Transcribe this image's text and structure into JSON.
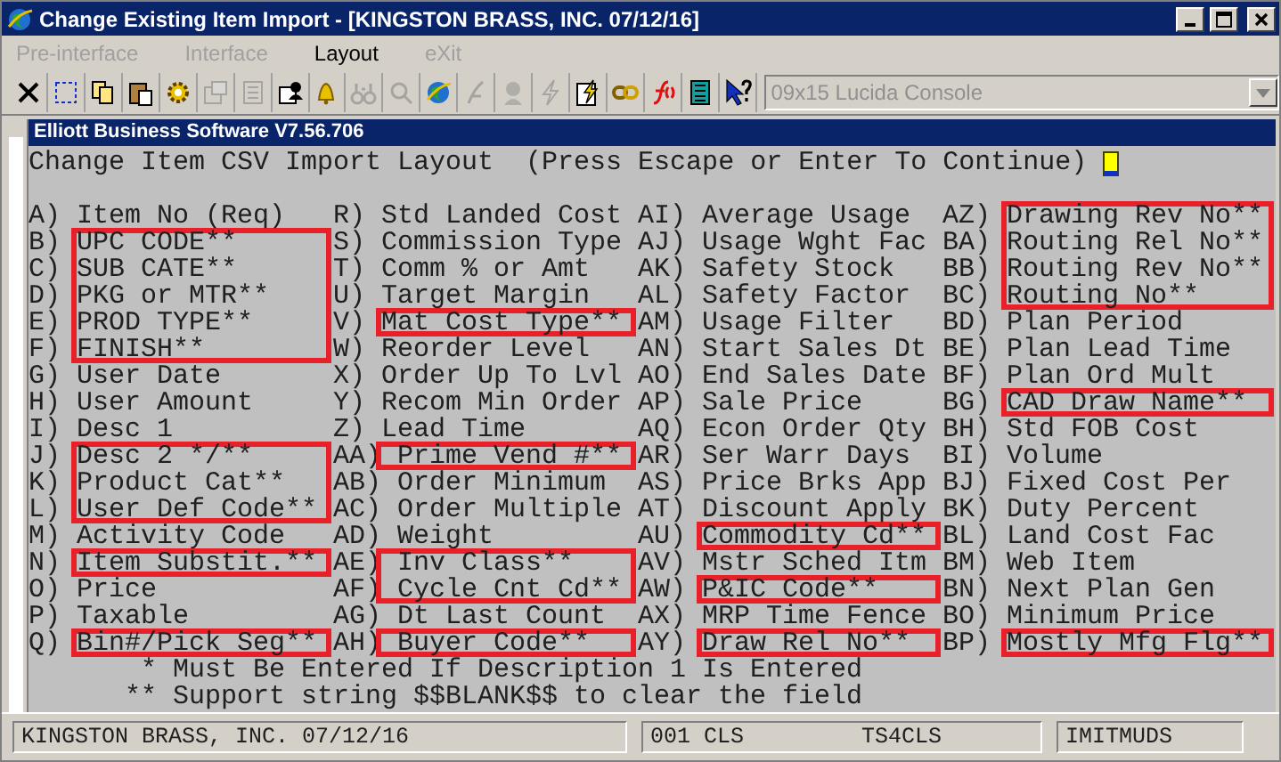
{
  "window": {
    "title": "Change Existing Item Import - [KINGSTON BRASS, INC. 07/12/16]"
  },
  "menu": [
    {
      "label": "Pre-interface",
      "disabled": true
    },
    {
      "label": "Interface",
      "disabled": true
    },
    {
      "label": "Layout",
      "disabled": false
    },
    {
      "label": "eXit",
      "disabled": true
    }
  ],
  "toolbar": {
    "buttons": [
      {
        "disabled": false
      },
      {
        "disabled": false
      },
      {
        "disabled": false
      },
      {
        "disabled": false
      },
      {
        "disabled": false
      },
      {
        "disabled": true
      },
      {
        "disabled": true
      },
      {
        "disabled": false
      },
      {
        "disabled": false
      },
      {
        "disabled": true
      },
      {
        "disabled": true
      },
      {
        "disabled": false
      },
      {
        "disabled": true
      },
      {
        "disabled": true
      },
      {
        "disabled": true
      },
      {
        "disabled": false
      },
      {
        "disabled": false
      },
      {
        "disabled": false
      },
      {
        "disabled": false
      },
      {
        "disabled": false
      }
    ],
    "font_select": {
      "value": "09x15 Lucida Console",
      "disabled": true
    }
  },
  "app_title": "Elliott Business Software V7.56.706",
  "screen": {
    "prompt": "Change Item CSV Import Layout  (Press Escape or Enter To Continue)",
    "columns": [
      [
        {
          "code": "A)",
          "label": "Item No (Req)",
          "highlighted": false
        },
        {
          "code": "B)",
          "label": "UPC CODE**",
          "highlighted": true
        },
        {
          "code": "C)",
          "label": "SUB CATE**",
          "highlighted": true
        },
        {
          "code": "D)",
          "label": "PKG or MTR**",
          "highlighted": true
        },
        {
          "code": "E)",
          "label": "PROD TYPE**",
          "highlighted": true
        },
        {
          "code": "F)",
          "label": "FINISH**",
          "highlighted": true
        },
        {
          "code": "G)",
          "label": "User Date",
          "highlighted": false
        },
        {
          "code": "H)",
          "label": "User Amount",
          "highlighted": false
        },
        {
          "code": "I)",
          "label": "Desc 1",
          "highlighted": false
        },
        {
          "code": "J)",
          "label": "Desc 2 */**",
          "highlighted": true
        },
        {
          "code": "K)",
          "label": "Product Cat**",
          "highlighted": true
        },
        {
          "code": "L)",
          "label": "User Def Code**",
          "highlighted": true
        },
        {
          "code": "M)",
          "label": "Activity Code",
          "highlighted": false
        },
        {
          "code": "N)",
          "label": "Item Substit.**",
          "highlighted": true
        },
        {
          "code": "O)",
          "label": "Price",
          "highlighted": false
        },
        {
          "code": "P)",
          "label": "Taxable",
          "highlighted": false
        },
        {
          "code": "Q)",
          "label": "Bin#/Pick Seg**",
          "highlighted": true
        }
      ],
      [
        {
          "code": "R)",
          "label": "Std Landed Cost",
          "highlighted": false
        },
        {
          "code": "S)",
          "label": "Commission Type",
          "highlighted": false
        },
        {
          "code": "T)",
          "label": "Comm % or Amt",
          "highlighted": false
        },
        {
          "code": "U)",
          "label": "Target Margin",
          "highlighted": false
        },
        {
          "code": "V)",
          "label": "Mat Cost Type**",
          "highlighted": true
        },
        {
          "code": "W)",
          "label": "Reorder Level",
          "highlighted": false
        },
        {
          "code": "X)",
          "label": "Order Up To Lvl",
          "highlighted": false
        },
        {
          "code": "Y)",
          "label": "Recom Min Order",
          "highlighted": false
        },
        {
          "code": "Z)",
          "label": "Lead Time",
          "highlighted": false
        },
        {
          "code": "AA)",
          "label": "Prime Vend #**",
          "highlighted": true
        },
        {
          "code": "AB)",
          "label": "Order Minimum",
          "highlighted": false
        },
        {
          "code": "AC)",
          "label": "Order Multiple",
          "highlighted": false
        },
        {
          "code": "AD)",
          "label": "Weight",
          "highlighted": false
        },
        {
          "code": "AE)",
          "label": "Inv Class**",
          "highlighted": true
        },
        {
          "code": "AF)",
          "label": "Cycle Cnt Cd**",
          "highlighted": true
        },
        {
          "code": "AG)",
          "label": "Dt Last Count",
          "highlighted": false
        },
        {
          "code": "AH)",
          "label": "Buyer Code**",
          "highlighted": true
        }
      ],
      [
        {
          "code": "AI)",
          "label": "Average Usage",
          "highlighted": false
        },
        {
          "code": "AJ)",
          "label": "Usage Wght Fac",
          "highlighted": false
        },
        {
          "code": "AK)",
          "label": "Safety Stock",
          "highlighted": false
        },
        {
          "code": "AL)",
          "label": "Safety Factor",
          "highlighted": false
        },
        {
          "code": "AM)",
          "label": "Usage Filter",
          "highlighted": false
        },
        {
          "code": "AN)",
          "label": "Start Sales Dt",
          "highlighted": false
        },
        {
          "code": "AO)",
          "label": "End Sales Date",
          "highlighted": false
        },
        {
          "code": "AP)",
          "label": "Sale Price",
          "highlighted": false
        },
        {
          "code": "AQ)",
          "label": "Econ Order Qty",
          "highlighted": false
        },
        {
          "code": "AR)",
          "label": "Ser Warr Days",
          "highlighted": false
        },
        {
          "code": "AS)",
          "label": "Price Brks App",
          "highlighted": false
        },
        {
          "code": "AT)",
          "label": "Discount Apply",
          "highlighted": false
        },
        {
          "code": "AU)",
          "label": "Commodity Cd**",
          "highlighted": true
        },
        {
          "code": "AV)",
          "label": "Mstr Sched Itm",
          "highlighted": false
        },
        {
          "code": "AW)",
          "label": "P&IC Code**",
          "highlighted": true
        },
        {
          "code": "AX)",
          "label": "MRP Time Fence",
          "highlighted": false
        },
        {
          "code": "AY)",
          "label": "Draw Rel No**",
          "highlighted": true
        }
      ],
      [
        {
          "code": "AZ)",
          "label": "Drawing Rev No**",
          "highlighted": true
        },
        {
          "code": "BA)",
          "label": "Routing Rel No**",
          "highlighted": true
        },
        {
          "code": "BB)",
          "label": "Routing Rev No**",
          "highlighted": true
        },
        {
          "code": "BC)",
          "label": "Routing No**",
          "highlighted": true
        },
        {
          "code": "BD)",
          "label": "Plan Period",
          "highlighted": false
        },
        {
          "code": "BE)",
          "label": "Plan Lead Time",
          "highlighted": false
        },
        {
          "code": "BF)",
          "label": "Plan Ord Mult",
          "highlighted": false
        },
        {
          "code": "BG)",
          "label": "CAD Draw Name**",
          "highlighted": true
        },
        {
          "code": "BH)",
          "label": "Std FOB Cost",
          "highlighted": false
        },
        {
          "code": "BI)",
          "label": "Volume",
          "highlighted": false
        },
        {
          "code": "BJ)",
          "label": "Fixed Cost Per",
          "highlighted": false
        },
        {
          "code": "BK)",
          "label": "Duty Percent",
          "highlighted": false
        },
        {
          "code": "BL)",
          "label": "Land Cost Fac",
          "highlighted": false
        },
        {
          "code": "BM)",
          "label": "Web Item",
          "highlighted": false
        },
        {
          "code": "BN)",
          "label": "Next Plan Gen",
          "highlighted": false
        },
        {
          "code": "BO)",
          "label": "Minimum Price",
          "highlighted": false
        },
        {
          "code": "BP)",
          "label": "Mostly Mfg Flg**",
          "highlighted": true
        }
      ]
    ],
    "notes": [
      {
        "mark": "*",
        "text": "Must Be Entered If Description 1 Is Entered"
      },
      {
        "mark": "**",
        "text": "Support string $$BLANK$$ to clear the field"
      }
    ]
  },
  "status_bar": [
    {
      "kind": "panel",
      "texts": [
        "KINGSTON BRASS, INC. 07/12/16"
      ]
    },
    {
      "kind": "panel",
      "texts": [
        "001 CLS",
        "TS4CLS"
      ]
    },
    {
      "kind": "panel",
      "texts": [
        "IMITMUDS"
      ]
    }
  ]
}
